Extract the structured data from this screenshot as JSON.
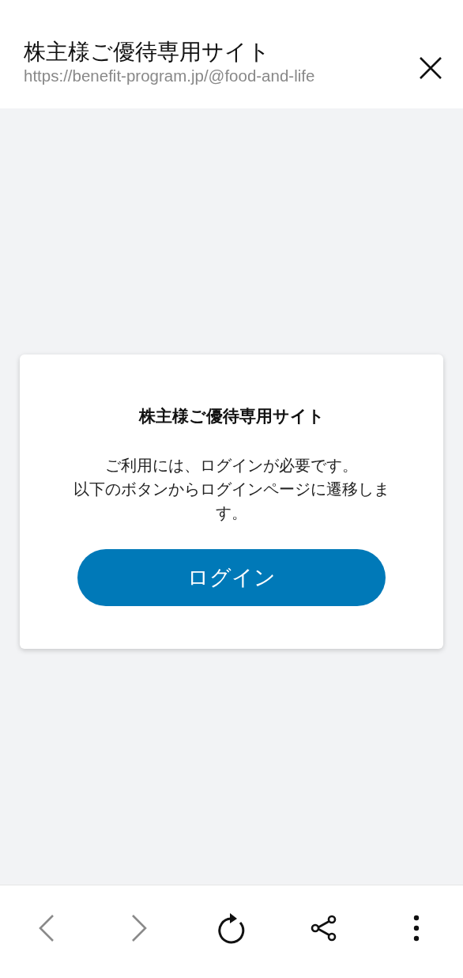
{
  "header": {
    "title": "株主様ご優待専用サイト",
    "url": "https://benefit-program.jp/@food-and-life"
  },
  "card": {
    "title": "株主様ご優待専用サイト",
    "message_lines": [
      "ご利用には、ログインが必要です。",
      "以下のボタンからログインページに遷移します。"
    ],
    "button": "ログイン"
  },
  "toolbar": [
    {
      "kind": "back",
      "disabled": true
    },
    {
      "kind": "forward",
      "disabled": true
    },
    {
      "kind": "reload",
      "disabled": false
    },
    {
      "kind": "share",
      "disabled": false
    },
    {
      "kind": "more",
      "disabled": false
    }
  ]
}
